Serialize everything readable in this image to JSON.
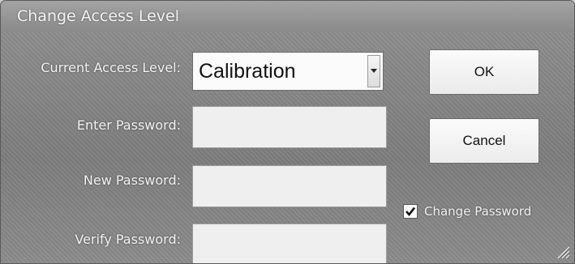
{
  "dialog": {
    "title": "Change Access Level",
    "current_access_label": "Current Access Level:",
    "current_access_value": "Calibration",
    "enter_password_label": "Enter Password:",
    "new_password_label": "New Password:",
    "verify_password_label": "Verify Password:",
    "change_password_label": "Change Password",
    "change_password_checked": true,
    "ok_label": "OK",
    "cancel_label": "Cancel"
  },
  "icons": {
    "dropdown": "chevron-down-icon",
    "check": "checkmark-icon",
    "resize": "resize-grip-icon"
  }
}
